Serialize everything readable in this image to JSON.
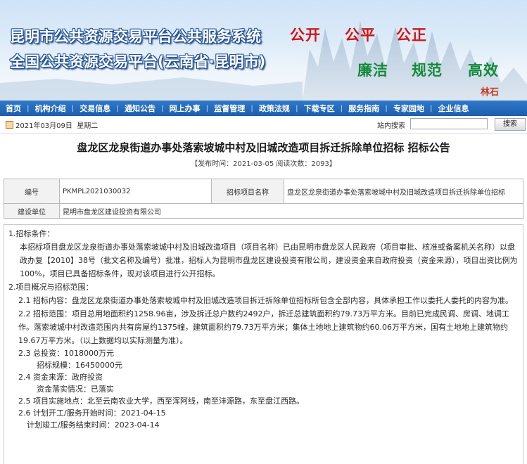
{
  "banner": {
    "title_line1": "昆明市公共资源交易平台公共服务系统",
    "title_line2": "全国公共资源交易平台(云南省·昆明市)",
    "slogans_red": [
      "公开",
      "公平",
      "公正"
    ],
    "slogans_green": [
      "廉洁",
      "规范",
      "高效"
    ],
    "brand": "林石",
    "colors": {
      "title_stroke": "#1d4f9a",
      "red": "#d41414",
      "green": "#148a3a",
      "nav": "#1d5fae"
    }
  },
  "nav": {
    "items": [
      "首页",
      "机构介绍",
      "交易信息",
      "通知公告",
      "网上办事",
      "监督管理",
      "政策法规",
      "下载专区",
      "服务指南",
      "专家园地",
      "企业信息"
    ]
  },
  "toolbar": {
    "date": "2021年03月09日",
    "weekday": "星期二",
    "search_label": "站内搜索",
    "search_value": "",
    "search_button": "搜索",
    "icon": "calendar-icon"
  },
  "article": {
    "title": "盘龙区龙泉街道办事处落索坡城中村及旧城改造项目拆迁拆除单位招标 招标公告",
    "meta": "【发布时间：2021-03-05 阅读次数：2093】",
    "info": {
      "code_label": "编号",
      "code_value": "PKMPL2021030032",
      "project_label": "招标项目名称",
      "project_value": "盘龙区龙泉街道办事处落索坡城中村及旧城改造项目拆迁拆除单位招标",
      "builder_label": "建设单位",
      "builder_value": "昆明市盘龙区建设投资有限公司"
    },
    "sections": {
      "s1_title": "1.招标条件：",
      "s1_body": "本招标项目盘龙区龙泉街道办事处落索坡城中村及旧城改造项目（项目名称）已由昆明市盘龙区人民政府（项目审批、核准或备案机关名称）以盘政办复【2010】38号（批文名称及编号）批准，招标人为昆明市盘龙区建设投资有限公司，建设资金来自政府投资（资金来源），项目出资比例为100%，项目已具备招标条件，现对该项目进行公开招标。",
      "s2_title": "2.项目概况与招标范围：",
      "s2_1": "2.1 招标内容：盘龙区龙泉街道办事处落索坡城中村及旧城改造项目拆迁拆除单位招标所包含全部内容，具体承担工作以委托人委托的内容为准。",
      "s2_2": "2.2 招标范围：项目总用地面积约1258.96亩，涉及拆迁总户数约2492户，拆迁总建筑面积约79.73万平方米。目前已完成民调、房调、地调工作。落索坡城中村改造范围内共有房屋约1375幢，建筑面积约79.73万平方米；集体土地地上建筑物约60.06万平方米，国有土地地上建筑物约19.67万平方米。（以上数据均以实际测量为准）。",
      "s2_3a": "2.3 总投资：1018000万元",
      "s2_3b": "招标规模：16450000元",
      "s2_4a": "2.4 资金来源：政府投资",
      "s2_4b": "资金落实情况：已落实",
      "s2_5": "2.5 项目实施地点：北至云南农业大学，西至浑阿线，南至沣源路，东至盘江西路。",
      "s2_6a": "2.6 计划开工/服务开始时间：2021-04-15",
      "s2_6b": "计划竣工/服务结束时间：2023-04-14"
    }
  }
}
